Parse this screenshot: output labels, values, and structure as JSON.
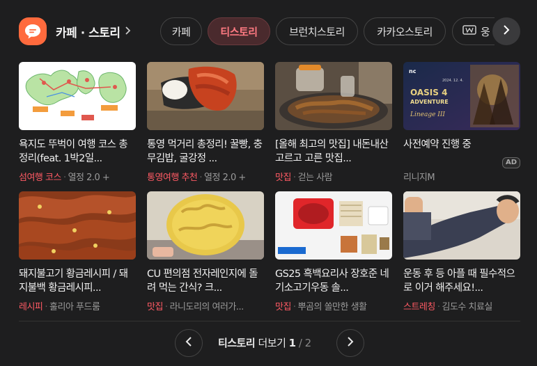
{
  "header": {
    "logo_icon": "chat-bubble-icon",
    "title": "카페 · 스토리",
    "accent": "#ff6a3d"
  },
  "tabs": [
    {
      "label": "카페",
      "active": false
    },
    {
      "label": "티스토리",
      "active": true
    },
    {
      "label": "브런치스토리",
      "active": false
    },
    {
      "label": "카카오스토리",
      "active": false
    },
    {
      "label": "웅",
      "icon": "currency-note-icon",
      "active": false
    }
  ],
  "cards": [
    {
      "title": "욕지도 뚜벅이 여행 코스 총정리(feat. 1박2일...",
      "category": "섬여행 코스",
      "source": "열정 2.0 +"
    },
    {
      "title": "통영 먹거리 총정리! 꿀빵, 충무김밥, 굴강정 ...",
      "category": "통영여행 추천",
      "source": "열정 2.0 +"
    },
    {
      "title": "[올해 최고의 맛집] 내돈내산 고르고 고른 맛집...",
      "category": "맛집",
      "source": "걷는 사람"
    },
    {
      "title": "사전예약 진행 중",
      "category": "",
      "source": "리니지M",
      "ad": "AD",
      "thumb_texts": {
        "brand": "nc",
        "date": "2024. 12. 4.",
        "headline1": "OASIS 4",
        "headline2": "ADVENTURE",
        "logo": "Lineage III"
      }
    },
    {
      "title": "돼지불고기 황금레시피 / 돼지불백 황금레시피...",
      "category": "레시피",
      "source": "훌리아 푸드룸"
    },
    {
      "title": "CU 편의점 전자레인지에 돌려 먹는 간식? 크...",
      "category": "맛집",
      "source": "라니도리의 여러가..."
    },
    {
      "title": "GS25 흑백요리사 장호준 네기소고기우동 솔...",
      "category": "맛집",
      "source": "뿌곰의 쏠만한 생활"
    },
    {
      "title": "운동 후 등 아플 때 필수적으로 이거 해주세요!...",
      "category": "스트레칭",
      "source": "김도수 치료실"
    }
  ],
  "pager": {
    "label_brand": "티스토리",
    "label_more": " 더보기 ",
    "current": "1",
    "slash": " / ",
    "total": "2"
  },
  "colors": {
    "background": "#1e1e1f",
    "category": "#ff5a64",
    "active_tab_bg": "#4a2a2d",
    "active_tab_text": "#ff7a82"
  }
}
